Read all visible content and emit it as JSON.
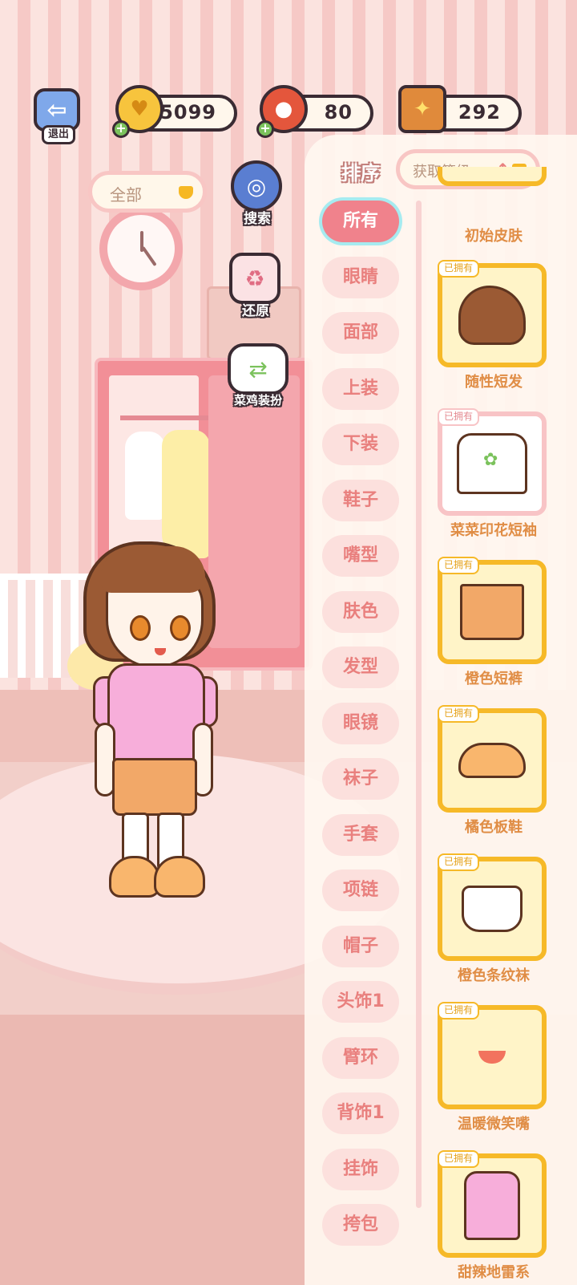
{
  "top_bar": {
    "exit_label": "退出",
    "currencies": [
      {
        "name": "coin",
        "value": "5099"
      },
      {
        "name": "cherry",
        "value": "80"
      },
      {
        "name": "book",
        "value": "292"
      }
    ]
  },
  "filter": {
    "label": "全部"
  },
  "side_buttons": {
    "search": "搜索",
    "restore": "还原",
    "chicken_dressup": "菜鸡装扮"
  },
  "sort": {
    "label": "排序",
    "value": "获取等级",
    "direction": "↑"
  },
  "categories": [
    "所有",
    "眼睛",
    "面部",
    "上装",
    "下装",
    "鞋子",
    "嘴型",
    "肤色",
    "发型",
    "眼镜",
    "袜子",
    "手套",
    "项链",
    "帽子",
    "头饰1",
    "臂环",
    "背饰1",
    "挂饰",
    "挎包"
  ],
  "active_category": "所有",
  "items": [
    {
      "name": "初始皮肤",
      "owned_label": "",
      "icon": "skin-icon"
    },
    {
      "name": "随性短发",
      "owned_label": "已拥有",
      "icon": "hair-icon"
    },
    {
      "name": "菜菜印花短袖",
      "owned_label": "已拥有",
      "icon": "tshirt-icon"
    },
    {
      "name": "橙色短裤",
      "owned_label": "已拥有",
      "icon": "shorts-icon"
    },
    {
      "name": "橘色板鞋",
      "owned_label": "已拥有",
      "icon": "shoes-icon"
    },
    {
      "name": "橙色条纹袜",
      "owned_label": "已拥有",
      "icon": "socks-icon"
    },
    {
      "name": "温暖微笑嘴",
      "owned_label": "已拥有",
      "icon": "mouth-icon"
    },
    {
      "name": "甜辣地雷系",
      "owned_label": "已拥有",
      "icon": "dress-icon"
    }
  ],
  "colors": {
    "accent_pink": "#f0828c",
    "category_bg": "#fce0dd",
    "card_border_gold": "#f6b928",
    "item_name": "#e08d45"
  }
}
